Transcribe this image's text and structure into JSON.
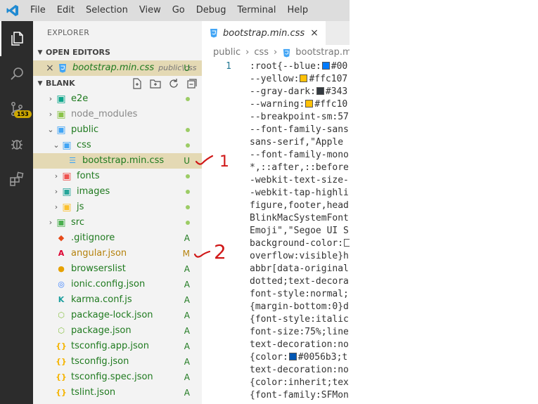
{
  "menu": [
    "File",
    "Edit",
    "Selection",
    "View",
    "Go",
    "Debug",
    "Terminal",
    "Help"
  ],
  "activity": {
    "scm_badge": "153"
  },
  "explorer": {
    "title": "EXPLORER",
    "open_editors": {
      "label": "OPEN EDITORS",
      "file": {
        "close": "×",
        "name": "bootstrap.min.css",
        "path": "public\\css",
        "status": "U"
      }
    },
    "folder": {
      "label": "BLANK",
      "tree": [
        {
          "name": "e2e",
          "depth": 0,
          "type": "folder",
          "expanded": false,
          "icon": "e2e-folder-icon",
          "color": "#0aa58a",
          "state": "dot"
        },
        {
          "name": "node_modules",
          "depth": 0,
          "type": "folder",
          "expanded": false,
          "icon": "node-folder-icon",
          "color": "#8bc34a",
          "state": "plain"
        },
        {
          "name": "public",
          "depth": 0,
          "type": "folder",
          "expanded": true,
          "icon": "public-folder-icon",
          "color": "#42a5f5",
          "state": "dot"
        },
        {
          "name": "css",
          "depth": 1,
          "type": "folder",
          "expanded": true,
          "icon": "css-folder-icon",
          "color": "#42a5f5",
          "state": "dot"
        },
        {
          "name": "bootstrap.min.css",
          "depth": 2,
          "type": "file",
          "icon": "css-file-icon",
          "color": "#42a5f5",
          "status": "U",
          "selected": true
        },
        {
          "name": "fonts",
          "depth": 1,
          "type": "folder",
          "expanded": false,
          "icon": "fonts-folder-icon",
          "color": "#ef5350",
          "state": "dot"
        },
        {
          "name": "images",
          "depth": 1,
          "type": "folder",
          "expanded": false,
          "icon": "images-folder-icon",
          "color": "#26a69a",
          "state": "dot"
        },
        {
          "name": "js",
          "depth": 1,
          "type": "folder",
          "expanded": false,
          "icon": "js-folder-icon",
          "color": "#fbc02d",
          "state": "dot"
        },
        {
          "name": "src",
          "depth": 0,
          "type": "folder",
          "expanded": false,
          "icon": "src-folder-icon",
          "color": "#4caf50",
          "state": "dot"
        },
        {
          "name": ".gitignore",
          "depth": 0,
          "type": "file",
          "icon": "git-icon",
          "color": "#e64a19",
          "status": "A"
        },
        {
          "name": "angular.json",
          "depth": 0,
          "type": "file",
          "icon": "angular-icon",
          "color": "#dd0031",
          "status": "M"
        },
        {
          "name": "browserslist",
          "depth": 0,
          "type": "file",
          "icon": "browserslist-icon",
          "color": "#e6a100",
          "status": "A"
        },
        {
          "name": "ionic.config.json",
          "depth": 0,
          "type": "file",
          "icon": "ionic-icon",
          "color": "#3880ff",
          "status": "A"
        },
        {
          "name": "karma.conf.js",
          "depth": 0,
          "type": "file",
          "icon": "karma-icon",
          "color": "#1b9e9e",
          "status": "A"
        },
        {
          "name": "package-lock.json",
          "depth": 0,
          "type": "file",
          "icon": "npm-package-icon",
          "color": "#8bc34a",
          "status": "A"
        },
        {
          "name": "package.json",
          "depth": 0,
          "type": "file",
          "icon": "npm-package-icon",
          "color": "#8bc34a",
          "status": "A"
        },
        {
          "name": "tsconfig.app.json",
          "depth": 0,
          "type": "file",
          "icon": "json-icon",
          "color": "#f5b400",
          "status": "A"
        },
        {
          "name": "tsconfig.json",
          "depth": 0,
          "type": "file",
          "icon": "json-icon",
          "color": "#f5b400",
          "status": "A"
        },
        {
          "name": "tsconfig.spec.json",
          "depth": 0,
          "type": "file",
          "icon": "json-icon",
          "color": "#f5b400",
          "status": "A"
        },
        {
          "name": "tslint.json",
          "depth": 0,
          "type": "file",
          "icon": "json-icon",
          "color": "#f5b400",
          "status": "A"
        }
      ]
    }
  },
  "editor": {
    "tab": {
      "name": "bootstrap.min.css",
      "close": "×"
    },
    "breadcrumb": [
      "public",
      "css",
      "bootstrap.min.c"
    ],
    "line_number": "1",
    "code_lines": [
      [
        ":root{--blue:",
        {
          "swatch": "#007bff"
        },
        "#00"
      ],
      [
        "--yellow:",
        {
          "swatch": "#ffc107"
        },
        "#ffc107"
      ],
      [
        "--gray-dark:",
        {
          "swatch": "#343a40"
        },
        "#343"
      ],
      [
        "--warning:",
        {
          "swatch": "#ffc107"
        },
        "#ffc10"
      ],
      [
        "--breakpoint-sm:57"
      ],
      [
        "--font-family-sans"
      ],
      [
        "sans-serif,\"Apple "
      ],
      [
        "--font-family-mono"
      ],
      [
        "*,::after,::before"
      ],
      [
        "-webkit-text-size-"
      ],
      [
        "-webkit-tap-highli"
      ],
      [
        "figure,footer,head"
      ],
      [
        "BlinkMacSystemFont"
      ],
      [
        "Emoji\",\"Segoe UI S"
      ],
      [
        "background-color:",
        {
          "swatch": "#ffffff"
        }
      ],
      [
        "overflow:visible}h"
      ],
      [
        "abbr[data-original"
      ],
      [
        "dotted;text-decora"
      ],
      [
        "font-style:normal;"
      ],
      [
        "{margin-bottom:0}d"
      ],
      [
        "{font-style:italic"
      ],
      [
        "font-size:75%;line"
      ],
      [
        "text-decoration:no"
      ],
      [
        "{color:",
        {
          "swatch": "#0056b3"
        },
        "#0056b3;t"
      ],
      [
        "text-decoration:no"
      ],
      [
        "{color:inherit;tex"
      ],
      [
        "{font-family:SFMon"
      ]
    ]
  },
  "annotations": [
    "1",
    "2"
  ],
  "colors": {
    "selection": "#e4d9b4",
    "untracked": "#1f7a1f",
    "modified": "#b5820d",
    "line_number": "#237893"
  }
}
